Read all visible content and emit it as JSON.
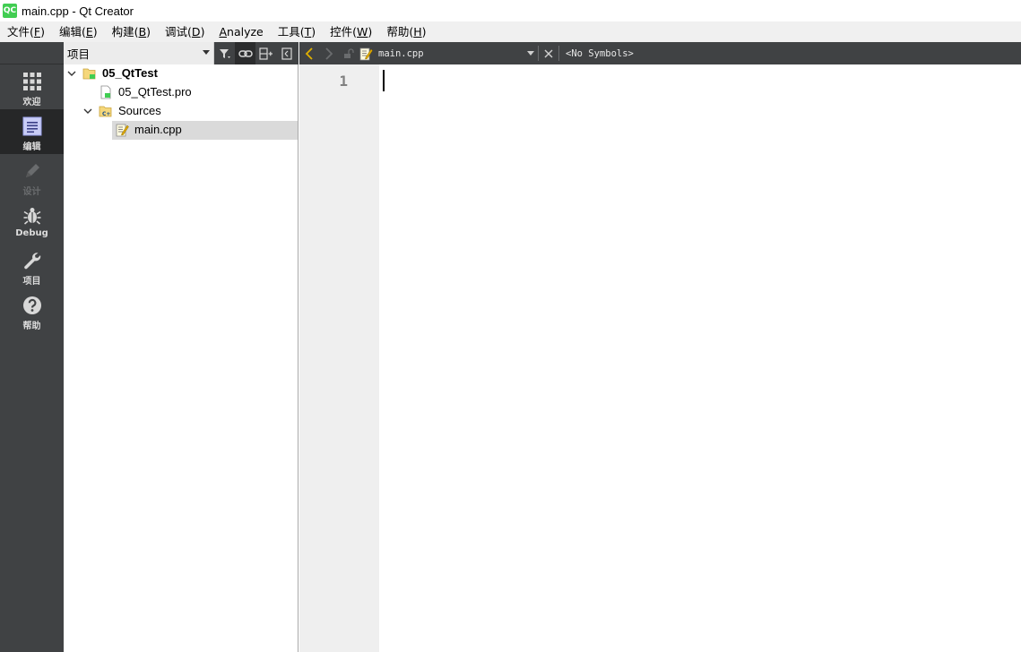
{
  "window": {
    "icon_text": "QC",
    "title": "main.cpp - Qt Creator"
  },
  "menu": [
    {
      "label": "文件(",
      "acc": "F",
      "tail": ")"
    },
    {
      "label": "编辑(",
      "acc": "E",
      "tail": ")"
    },
    {
      "label": "构建(",
      "acc": "B",
      "tail": ")"
    },
    {
      "label": "调试(",
      "acc": "D",
      "tail": ")"
    },
    {
      "label": "",
      "acc": "A",
      "tail": "nalyze"
    },
    {
      "label": "工具(",
      "acc": "T",
      "tail": ")"
    },
    {
      "label": "控件(",
      "acc": "W",
      "tail": ")"
    },
    {
      "label": "帮助(",
      "acc": "H",
      "tail": ")"
    }
  ],
  "modes": [
    {
      "label": "欢迎",
      "icon": "grid-icon"
    },
    {
      "label": "编辑",
      "icon": "edit-document-icon"
    },
    {
      "label": "设计",
      "icon": "pencil-icon"
    },
    {
      "label": "Debug",
      "icon": "bug-icon"
    },
    {
      "label": "项目",
      "icon": "wrench-icon"
    },
    {
      "label": "帮助",
      "icon": "help-icon"
    }
  ],
  "project_panel": {
    "selector_label": "项目",
    "tree": [
      {
        "label": "05_QtTest",
        "bold": true,
        "icon": "project-folder-icon"
      },
      {
        "label": "05_QtTest.pro",
        "bold": false,
        "icon": "pro-file-icon"
      },
      {
        "label": "Sources",
        "bold": false,
        "icon": "sources-folder-icon"
      },
      {
        "label": "main.cpp",
        "bold": false,
        "icon": "cpp-file-icon"
      }
    ]
  },
  "editor": {
    "file_name": "main.cpp",
    "symbols": "<No Symbols>",
    "line_numbers": [
      "1"
    ]
  },
  "colors": {
    "sidebar_bg": "#404244",
    "sidebar_active": "#262728",
    "back_arrow": "#e0b000",
    "gutter_bg": "#efefef"
  }
}
